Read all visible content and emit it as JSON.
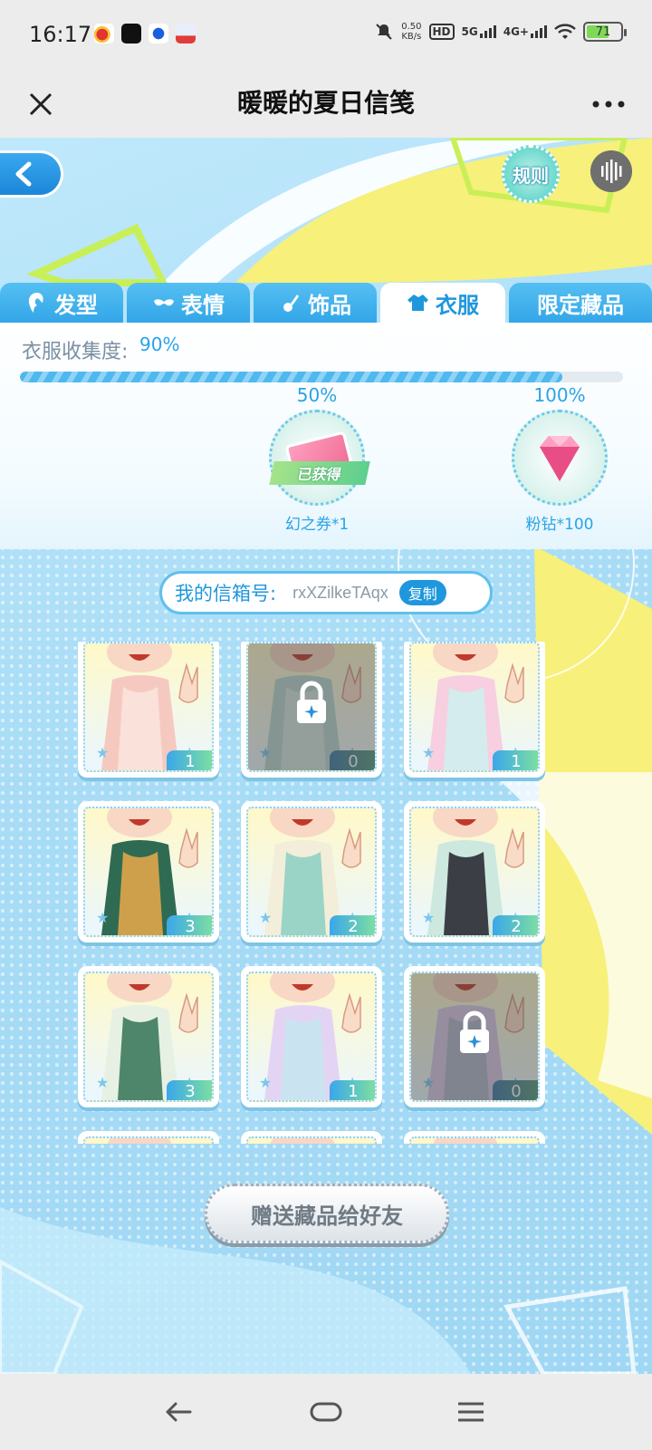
{
  "status_bar": {
    "time": "16:17",
    "net_speed": "0.50\nKB/s",
    "net_speed_top": "0.50",
    "net_speed_bottom": "KB/s",
    "hd": "HD",
    "signal1": "5G",
    "signal2": "4G+",
    "battery": "71",
    "battery_level": 0.71
  },
  "title_bar": {
    "title": "暖暖的夏日信笺"
  },
  "header": {
    "rules_label": "规则"
  },
  "tabs": [
    {
      "label": "发型",
      "icon": "hair-icon",
      "active": false
    },
    {
      "label": "表情",
      "icon": "mask-icon",
      "active": false
    },
    {
      "label": "饰品",
      "icon": "accessory-icon",
      "active": false
    },
    {
      "label": "衣服",
      "icon": "clothes-icon",
      "active": true
    },
    {
      "label": "限定藏品",
      "icon": "",
      "active": false
    }
  ],
  "progress": {
    "label": "衣服收集度:",
    "value": "90%",
    "fraction": 0.9,
    "milestones": [
      {
        "pct": "50%",
        "reward": "幻之券*1",
        "status": "已获得",
        "icon": "ticket-icon"
      },
      {
        "pct": "100%",
        "reward": "粉钻*100",
        "icon": "pink-diamond-icon"
      }
    ]
  },
  "mailbox": {
    "label": "我的信箱号:",
    "id": "rxXZilkeTAqx",
    "copy_label": "复制"
  },
  "items": [
    {
      "count": "1",
      "locked": false,
      "colors": [
        "#f6c9c0",
        "#fbe3dc"
      ]
    },
    {
      "count": "0",
      "locked": true,
      "colors": [
        "#b9d8cf",
        "#d7e8e2"
      ]
    },
    {
      "count": "1",
      "locked": false,
      "colors": [
        "#f7cfe0",
        "#cfeef0"
      ]
    },
    {
      "count": "3",
      "locked": false,
      "colors": [
        "#2f6b52",
        "#e0a64a"
      ]
    },
    {
      "count": "2",
      "locked": false,
      "colors": [
        "#f3eed9",
        "#8fd0c4"
      ]
    },
    {
      "count": "2",
      "locked": false,
      "colors": [
        "#cde8df",
        "#2b2b33"
      ]
    },
    {
      "count": "3",
      "locked": false,
      "colors": [
        "#e6f1e3",
        "#3d7a5e"
      ]
    },
    {
      "count": "1",
      "locked": false,
      "colors": [
        "#e4d4f4",
        "#c5e6f0"
      ]
    },
    {
      "count": "0",
      "locked": true,
      "colors": [
        "#d8c6e8",
        "#a9b4c8"
      ]
    },
    {
      "count": "",
      "locked": false,
      "colors": [
        "#fbe9c6",
        "#f6c9c0"
      ]
    },
    {
      "count": "",
      "locked": false,
      "colors": [
        "#fbe9c6",
        "#f6c9c0"
      ]
    },
    {
      "count": "",
      "locked": false,
      "colors": [
        "#fbe9c6",
        "#f6c9c0"
      ]
    }
  ],
  "gift_button": {
    "label": "赠送藏品给好友"
  },
  "colors": {
    "accent": "#1e97dd",
    "tab_bg": "#33a6e8",
    "page_bg": "#a8dcf6"
  }
}
